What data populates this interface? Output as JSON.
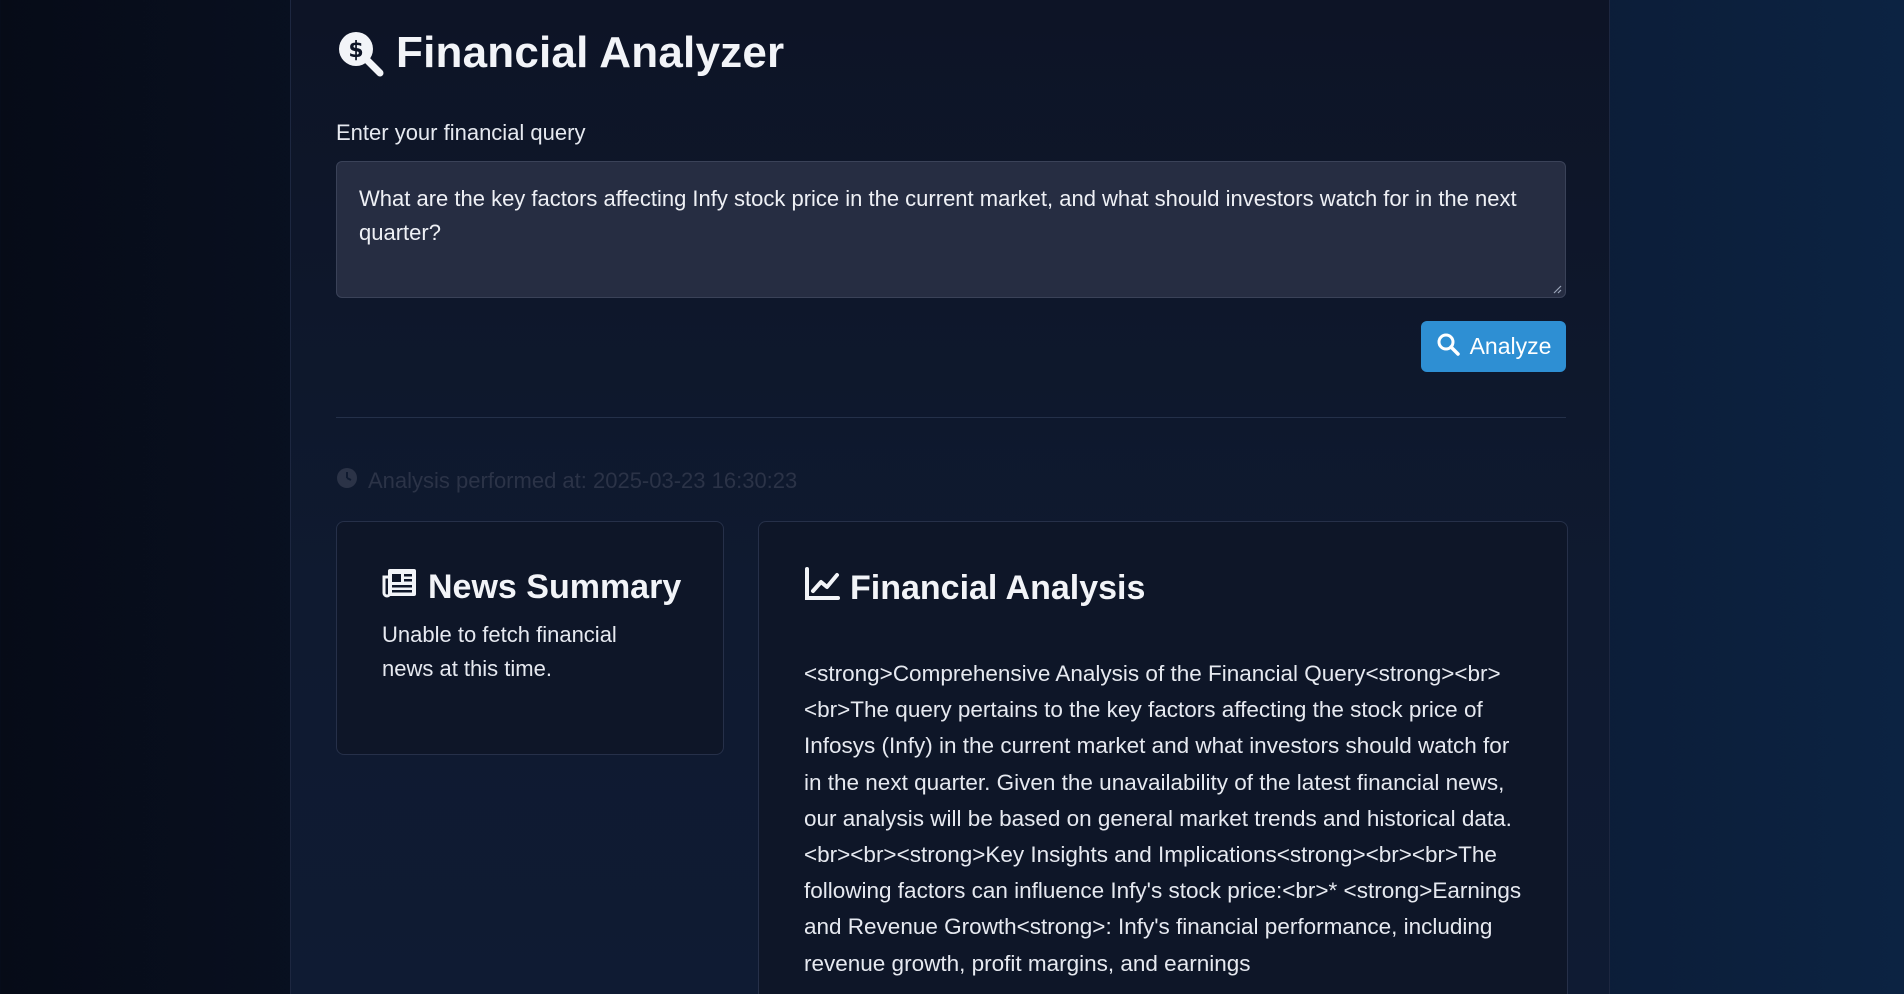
{
  "app": {
    "title": "Financial Analyzer",
    "title_icon": "search-dollar-icon"
  },
  "query": {
    "label": "Enter your financial query",
    "value": "What are the key factors affecting Infy stock price in the current market, and what should investors watch for in the next quarter?"
  },
  "analyze_button": {
    "label": "Analyze",
    "icon": "search-icon",
    "color": "#2e8fd3"
  },
  "timestamp": {
    "icon": "clock-icon",
    "text": "Analysis performed at: 2025-03-23 16:30:23"
  },
  "news_card": {
    "icon": "newspaper-icon",
    "title": "News Summary",
    "body": "Unable to fetch financial news at this time."
  },
  "analysis_card": {
    "icon": "chart-line-icon",
    "title": "Financial Analysis",
    "body": "<strong>Comprehensive Analysis of the Financial Query<strong><br><br>The query pertains to the key factors affecting the stock price of Infosys (Infy) in the current market and what investors should watch for in the next quarter. Given the unavailability of the latest financial news, our analysis will be based on general market trends and historical data.<br><br><strong>Key Insights and Implications<strong><br><br>The following factors can influence Infy's stock price:<br>* <strong>Earnings and Revenue Growth<strong>: Infy's financial performance, including revenue growth, profit margins, and earnings"
  },
  "colors": {
    "background": "#0b1428",
    "panel": "#0d1426",
    "input_bg": "#262d42",
    "accent": "#2e8fd3"
  }
}
